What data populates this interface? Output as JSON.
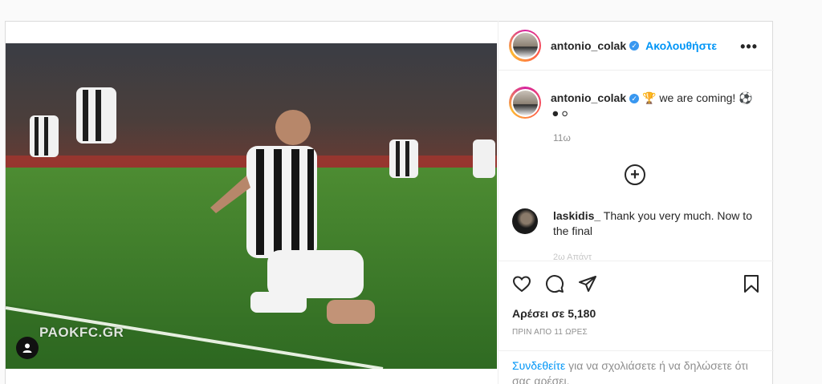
{
  "post": {
    "author": "antonio_colak",
    "verified_glyph": "✓",
    "follow_label": "Ακολουθήστε",
    "more_icon": "more-horizontal-icon",
    "watermark": "PAOKFC.GR",
    "caption": {
      "username": "antonio_colak",
      "text": "we are coming!",
      "emoji_trophy": "🏆",
      "emoji_ball": "⚽",
      "emoji_circles": "⚫⚪",
      "time": "11ω"
    },
    "comments": [
      {
        "username": "laskidis_",
        "text": "Thank you very much. Now to the final"
      }
    ],
    "comment_partial": "2ω  Απάντ",
    "likes": "Αρέσει σε 5,180",
    "posted_ago": "ΠΡΙΝ ΑΠΟ 11 ΩΡΕΣ",
    "login_prompt": {
      "link": "Συνδεθείτε",
      "text": " για να σχολιάσετε ή να δηλώσετε ότι σας αρέσει."
    }
  },
  "colors": {
    "accent": "#0095f6",
    "verified": "#3897f0",
    "pitch": "#3f7d2a",
    "muted": "#8e8e8e"
  }
}
